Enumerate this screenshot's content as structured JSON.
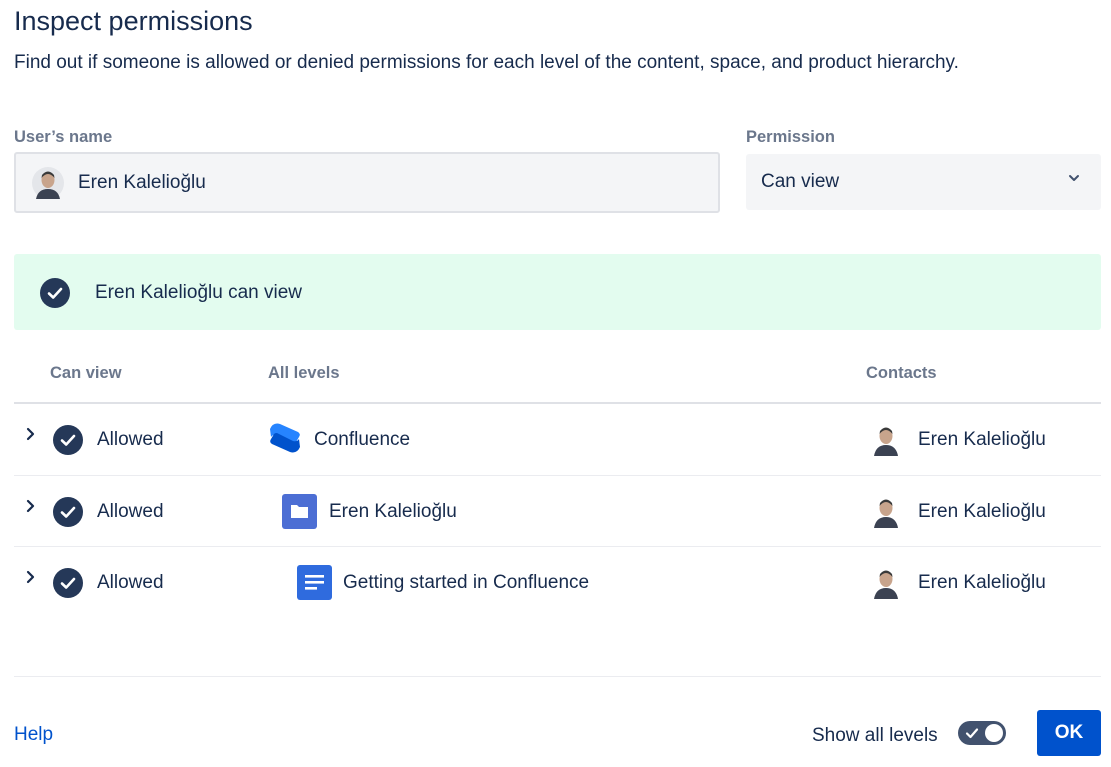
{
  "dialog": {
    "title": "Inspect permissions",
    "subtitle": "Find out if someone is allowed or denied permissions for each level of the content, space, and product hierarchy."
  },
  "form": {
    "user_label": "User’s name",
    "user_value": "Eren Kalelioğlu",
    "permission_label": "Permission",
    "permission_value": "Can view"
  },
  "banner": {
    "message": "Eren Kalelioğlu can view",
    "background": "#e3fcef"
  },
  "table": {
    "headers": {
      "status": "Can view",
      "levels": "All levels",
      "contacts": "Contacts"
    },
    "rows": [
      {
        "status": "Allowed",
        "level": "Confluence",
        "level_icon": "confluence-logo-icon",
        "contact": "Eren Kalelioğlu"
      },
      {
        "status": "Allowed",
        "level": "Eren Kalelioğlu",
        "level_icon": "space-folder-icon",
        "contact": "Eren Kalelioğlu"
      },
      {
        "status": "Allowed",
        "level": "Getting started in Confluence",
        "level_icon": "page-document-icon",
        "contact": "Eren Kalelioğlu"
      }
    ]
  },
  "footer": {
    "help_label": "Help",
    "show_all_label": "Show all levels",
    "show_all_enabled": true,
    "ok_label": "OK"
  },
  "colors": {
    "primary": "#0052cc",
    "text": "#172b4d",
    "subtle": "#6b778c",
    "check": "#253858"
  }
}
